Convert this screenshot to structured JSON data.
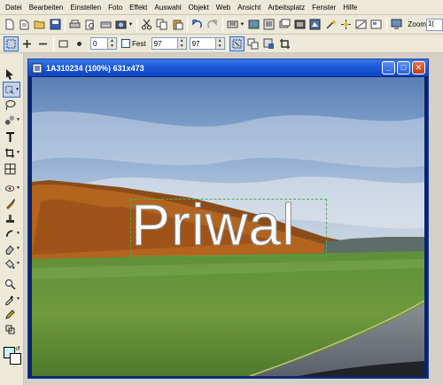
{
  "menu": {
    "items": [
      {
        "label": "Datei"
      },
      {
        "label": "Bearbeiten"
      },
      {
        "label": "Einstellen"
      },
      {
        "label": "Foto"
      },
      {
        "label": "Effekt"
      },
      {
        "label": "Auswahl"
      },
      {
        "label": "Objekt"
      },
      {
        "label": "Web"
      },
      {
        "label": "Ansicht"
      },
      {
        "label": "Arbeitsplatz"
      },
      {
        "label": "Fenster"
      },
      {
        "label": "Hilfe"
      }
    ]
  },
  "toolbar": {
    "zoom_label": "Zoom",
    "zoom_value": "1("
  },
  "options_bar": {
    "angle_value": "0",
    "fixed_label": "Fest",
    "width_value": "97",
    "height_value": "97"
  },
  "document": {
    "title": "1A310234 (100%) 631x473",
    "overlay_text": "Priwal"
  },
  "colors": {
    "title_bar": "#1c5bd9",
    "close_button": "#c33d1c",
    "watermark_outline": "#4caf50",
    "foreground_swatch": "#c8f4f8",
    "background_swatch": "#ffffff"
  }
}
